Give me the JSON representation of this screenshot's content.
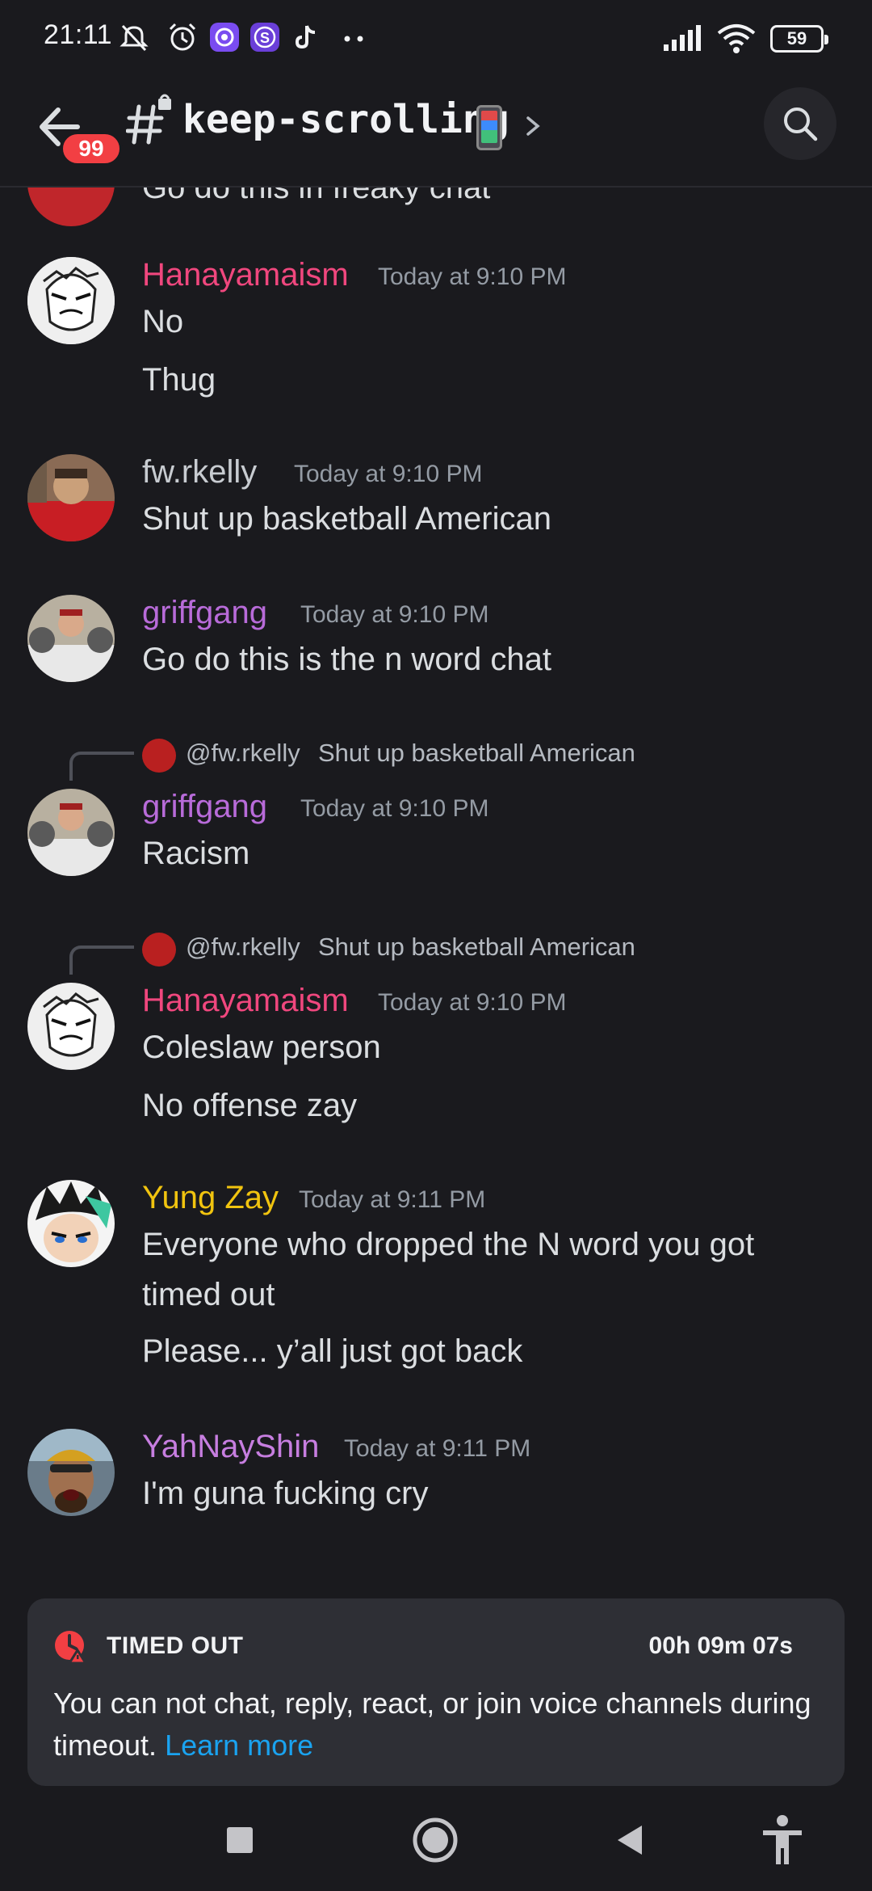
{
  "status_bar": {
    "time": "21:11",
    "battery": "59",
    "icons": [
      "mute-icon",
      "alarm-icon",
      "app-icon-purple",
      "app-icon-s",
      "tiktok-icon",
      "more-dots-icon",
      "signal-icon",
      "wifi-icon",
      "battery-icon"
    ]
  },
  "header": {
    "badge": "99",
    "channel_name": "keep-scrolling",
    "icons": [
      "back-arrow-icon",
      "locked-hash-icon",
      "phone-emoji",
      "chevron-right-icon",
      "search-icon"
    ]
  },
  "messages": {
    "partial_text": "Go do this in freaky chat",
    "items": [
      {
        "username": "Hanayamaism",
        "color": "#f0477e",
        "timestamp": "Today at 9:10 PM",
        "lines": [
          "No",
          "Thug"
        ]
      },
      {
        "username": "fw.rkelly",
        "color": "#c8ccd1",
        "timestamp": "Today at 9:10 PM",
        "lines": [
          "Shut up basketball American"
        ]
      },
      {
        "username": "griffgang",
        "color": "#b86bd9",
        "timestamp": "Today at 9:10 PM",
        "lines": [
          "Go do this is the n word chat"
        ]
      },
      {
        "reply": {
          "name": "@fw.rkelly",
          "text": "Shut up basketball American"
        },
        "username": "griffgang",
        "color": "#b86bd9",
        "timestamp": "Today at 9:10 PM",
        "lines": [
          "Racism"
        ]
      },
      {
        "reply": {
          "name": "@fw.rkelly",
          "text": "Shut up basketball American"
        },
        "username": "Hanayamaism",
        "color": "#f0477e",
        "timestamp": "Today at 9:10 PM",
        "lines": [
          "Coleslaw person",
          "No offense zay"
        ]
      },
      {
        "username": "Yung Zay",
        "color": "#f1c40f",
        "timestamp": "Today at 9:11 PM",
        "lines": [
          "Everyone who dropped the N word you got",
          "timed out",
          "Please... y’all just got back"
        ]
      },
      {
        "username": "YahNayShin",
        "color": "#c77ee0",
        "timestamp": "Today at 9:11 PM",
        "lines": [
          "I'm guna fucking cry"
        ]
      }
    ]
  },
  "timeout": {
    "title": "TIMED OUT",
    "timer": "00h 09m 07s",
    "body": "You can not chat, reply, react, or join voice channels during timeout.",
    "link": "Learn more",
    "accent": "#f23f43",
    "link_color": "#1aa3f0"
  },
  "navbar": {
    "icons": [
      "recents-square-icon",
      "home-circle-icon",
      "back-triangle-icon",
      "accessibility-icon"
    ]
  }
}
